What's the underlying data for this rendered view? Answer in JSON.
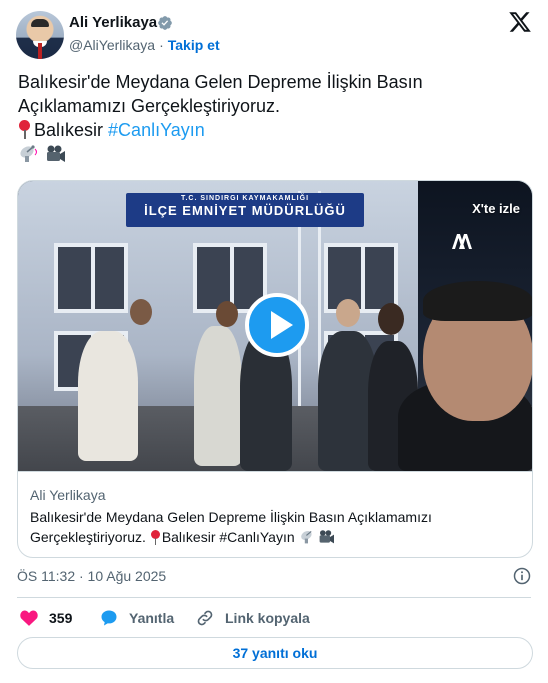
{
  "author": {
    "name": "Ali Yerlikaya",
    "handle": "@AliYerlikaya",
    "separator": "·",
    "follow_label": "Takip et"
  },
  "tweet": {
    "line1": "Balıkesir'de Meydana Gelen Depreme İlişkin Basın",
    "line2": "Açıklamamızı Gerçekleştiriyoruz.",
    "location": "Balıkesir",
    "hashtag": "#CanlıYayın",
    "icons": [
      "round-pushpin-icon",
      "satellite-antenna-icon",
      "movie-camera-icon"
    ]
  },
  "media": {
    "watch_on_x_label": "X'te izle",
    "sign_small": "T.C. SINDIRGI KAYMAKAMLIĞI",
    "sign_big": "İLÇE EMNİYET MÜDÜRLÜĞÜ",
    "card_author": "Ali Yerlikaya",
    "card_desc_line1": "Balıkesir'de Meydana Gelen Depreme İlişkin Basın Açıklamamızı",
    "card_desc_line2_a": "Gerçekleştiriyoruz.",
    "card_desc_line2_b": "Balıkesir #CanlıYayın"
  },
  "timestamp": "ÖS 11:32 · 10 Ağu 2025",
  "actions": {
    "like_count": "359",
    "reply_label": "Yanıtla",
    "copy_label": "Link kopyala"
  },
  "read_replies_label": "37 yanıtı oku",
  "colors": {
    "accent": "#1d9bf0",
    "link": "#006fd6",
    "like": "#f91880",
    "muted": "#536471",
    "border": "#cfd9de"
  }
}
